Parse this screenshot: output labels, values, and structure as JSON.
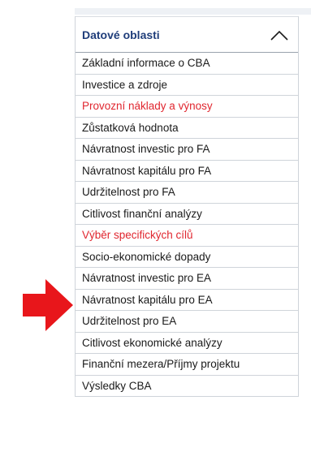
{
  "panel": {
    "title": "Datové oblasti",
    "toggle_icon": "chevron-up-icon",
    "items": [
      {
        "label": "Základní informace o CBA",
        "color": "#1a1a1a"
      },
      {
        "label": "Investice a zdroje",
        "color": "#1a1a1a"
      },
      {
        "label": "Provozní náklady a výnosy",
        "color": "#e0262f"
      },
      {
        "label": "Zůstatková hodnota",
        "color": "#1a1a1a"
      },
      {
        "label": "Návratnost investic pro FA",
        "color": "#1a1a1a"
      },
      {
        "label": "Návratnost kapitálu pro FA",
        "color": "#1a1a1a"
      },
      {
        "label": "Udržitelnost pro FA",
        "color": "#1a1a1a"
      },
      {
        "label": "Citlivost finanční analýzy",
        "color": "#1a1a1a"
      },
      {
        "label": "Výběr specifických cílů",
        "color": "#e0262f"
      },
      {
        "label": "Socio-ekonomické dopady",
        "color": "#1a1a1a"
      },
      {
        "label": "Návratnost investic pro EA",
        "color": "#1a1a1a"
      },
      {
        "label": "Návratnost kapitálu pro EA",
        "color": "#1a1a1a"
      },
      {
        "label": "Udržitelnost pro EA",
        "color": "#1a1a1a"
      },
      {
        "label": "Citlivost ekonomické analýzy",
        "color": "#1a1a1a"
      },
      {
        "label": "Finanční mezera/Příjmy projektu",
        "color": "#1a1a1a"
      },
      {
        "label": "Výsledky CBA",
        "color": "#1a1a1a"
      }
    ]
  },
  "annotation": {
    "icon": "red-arrow-right-icon",
    "color": "#e8161b"
  }
}
